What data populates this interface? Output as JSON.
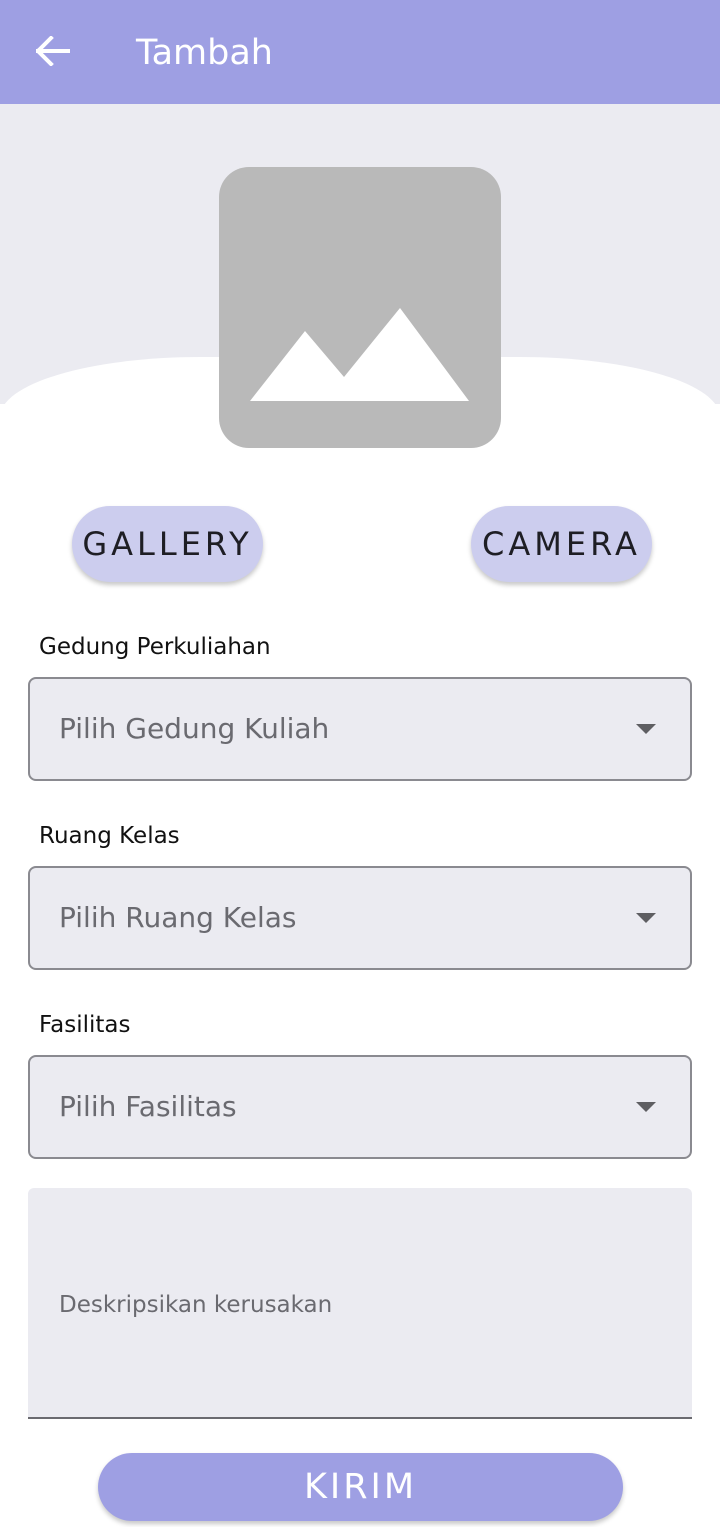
{
  "appbar": {
    "title": "Tambah",
    "back_icon": "arrow-left-icon",
    "color": "#9e9fe3"
  },
  "image_picker": {
    "placeholder_icon": "image-placeholder-icon",
    "gallery_label": "GALLERY",
    "camera_label": "CAMERA"
  },
  "form": {
    "building": {
      "label": "Gedung Perkuliahan",
      "placeholder": "Pilih Gedung Kuliah"
    },
    "room": {
      "label": "Ruang Kelas",
      "placeholder": "Pilih Ruang Kelas"
    },
    "facility": {
      "label": "Fasilitas",
      "placeholder": "Pilih Fasilitas"
    },
    "description": {
      "placeholder": "Deskripsikan kerusakan"
    },
    "submit_label": "KIRIM"
  },
  "colors": {
    "accent": "#9e9fe3",
    "pill": "#cccdee",
    "field_bg": "#ebebf1"
  }
}
